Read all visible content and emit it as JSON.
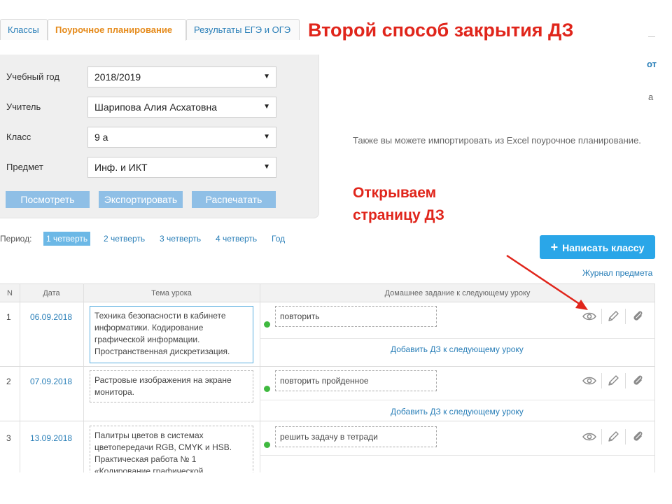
{
  "tabs": [
    {
      "label": "Классы"
    },
    {
      "label": "Поурочное планирование",
      "active": true
    },
    {
      "label": "Результаты ЕГЭ и ОГЭ"
    }
  ],
  "headline": "Второй способ закрытия ДЗ",
  "edge_text_1": "от",
  "edge_text_2": "а",
  "filters": [
    {
      "label": "Учебный год",
      "value": "2018/2019"
    },
    {
      "label": "Учитель",
      "value": "Шарипова Алия Асхатовна"
    },
    {
      "label": "Класс",
      "value": "9 а"
    },
    {
      "label": "Предмет",
      "value": "Инф. и ИКТ"
    }
  ],
  "filter_buttons": [
    "Посмотреть",
    "Экспортировать",
    "Распечатать"
  ],
  "import_text": "Также вы можете импортировать из Excel поурочное планирование.",
  "annotation": {
    "line1": "Открываем",
    "line2": "страницу ДЗ"
  },
  "period": {
    "label": "Период:",
    "items": [
      "1 четверть",
      "2 четверть",
      "3 четверть",
      "4 четверть",
      "Год"
    ],
    "active_index": 0
  },
  "write_button": {
    "plus": "+",
    "label": "Написать классу"
  },
  "journal_link": "Журнал предмета",
  "table": {
    "headers": {
      "num": "N",
      "date": "Дата",
      "topic": "Тема урока",
      "homework": "Домашнее задание к следующему уроку"
    },
    "add_hw_label": "Добавить ДЗ к следующему уроку",
    "rows": [
      {
        "num": "1",
        "date": "06.09.2018",
        "topic": "Техника безопасности в кабинете информатики. Кодирование графической информации. Пространственная дискретизация.",
        "homework": "повторить"
      },
      {
        "num": "2",
        "date": "07.09.2018",
        "topic": "Растровые изображения на экране монитора.",
        "homework": "повторить пройденное"
      },
      {
        "num": "3",
        "date": "13.09.2018",
        "topic": "Палитры цветов в системах цветопередачи RGB, CMYK и HSB. Практическая работа № 1 «Кодирование графической",
        "homework": "решить задачу в тетради"
      }
    ]
  },
  "colors": {
    "accent": "#2aa6e8",
    "headline": "#e0251b",
    "active_tab": "#e58b1c",
    "link": "#2a7fb8",
    "status_dot": "#3fb93f"
  },
  "icons": [
    "eye-icon",
    "pencil-icon",
    "paperclip-icon"
  ]
}
